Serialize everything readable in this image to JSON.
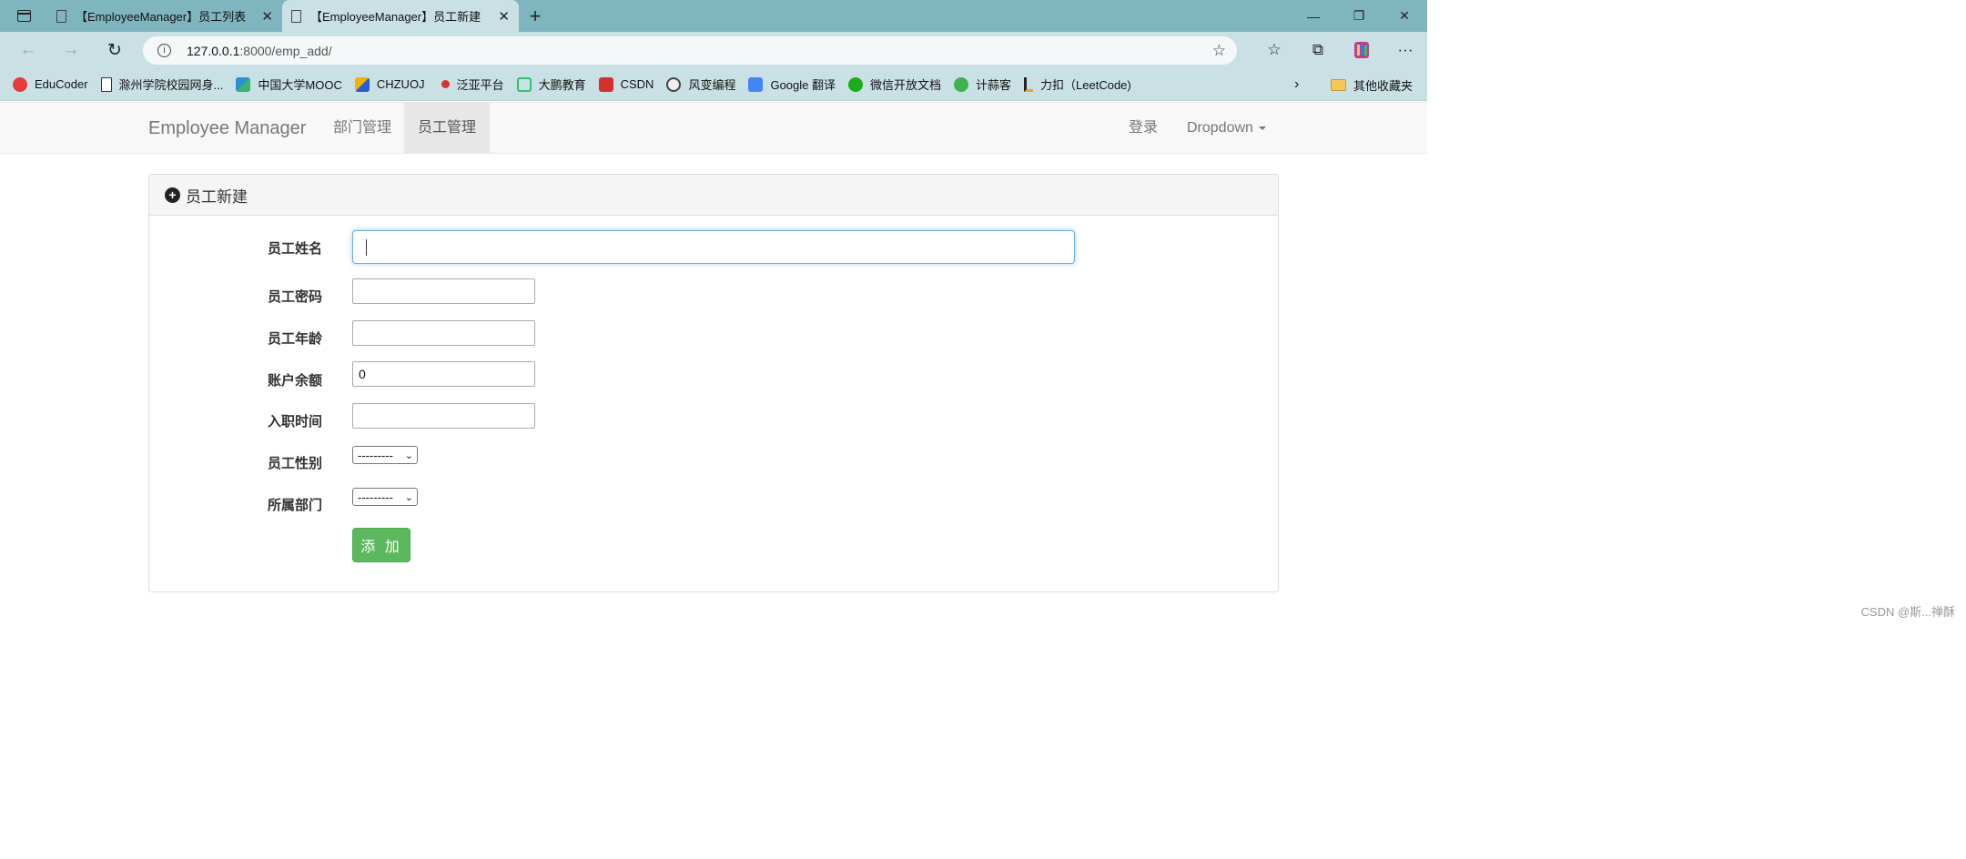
{
  "browser": {
    "tabs": [
      {
        "title": "【EmployeeManager】员工列表",
        "active": false
      },
      {
        "title": "【EmployeeManager】员工新建",
        "active": true
      }
    ],
    "url_host": "127.0.0.1",
    "url_path": ":8000/emp_add/",
    "bookmarks": [
      {
        "label": "EduCoder",
        "icon": "toutiao-icon",
        "color": "#e33c3c"
      },
      {
        "label": "滁州学院校园网身...",
        "icon": "page-icon",
        "color": "#ffffff"
      },
      {
        "label": "中国大学MOOC",
        "icon": "mooc-icon",
        "color": "#2a8fd3"
      },
      {
        "label": "CHZUOJ",
        "icon": "chzuoj-icon",
        "color": "#f0b400"
      },
      {
        "label": "泛亚平台",
        "icon": "fanya-icon",
        "color": "#d9302c"
      },
      {
        "label": "大鹏教育",
        "icon": "dapeng-icon",
        "color": "#2ec46a"
      },
      {
        "label": "CSDN",
        "icon": "csdn-icon",
        "color": "#d32f2f"
      },
      {
        "label": "风变编程",
        "icon": "panda-icon",
        "color": "#555555"
      },
      {
        "label": "Google 翻译",
        "icon": "google-translate-icon",
        "color": "#4285f4"
      },
      {
        "label": "微信开放文档",
        "icon": "wechat-icon",
        "color": "#1aad19"
      },
      {
        "label": "计蒜客",
        "icon": "jisuanke-icon",
        "color": "#3fb24f"
      },
      {
        "label": "力扣（LeetCode)",
        "icon": "leetcode-icon",
        "color": "#f89f1b"
      }
    ],
    "other_bookmarks": "其他收藏夹"
  },
  "navbar": {
    "brand": "Employee Manager",
    "links": [
      {
        "label": "部门管理",
        "active": false
      },
      {
        "label": "员工管理",
        "active": true
      }
    ],
    "login": "登录",
    "dropdown": "Dropdown"
  },
  "panel": {
    "title": "员工新建",
    "fields": {
      "name": {
        "label": "员工姓名",
        "value": ""
      },
      "password": {
        "label": "员工密码",
        "value": ""
      },
      "age": {
        "label": "员工年龄",
        "value": ""
      },
      "balance": {
        "label": "账户余额",
        "value": "0"
      },
      "hire_date": {
        "label": "入职时间",
        "value": ""
      },
      "gender": {
        "label": "员工性别",
        "selected": "---------"
      },
      "department": {
        "label": "所属部门",
        "selected": "---------"
      }
    },
    "submit": "添 加"
  },
  "watermark": "CSDN @斯...禅酥"
}
